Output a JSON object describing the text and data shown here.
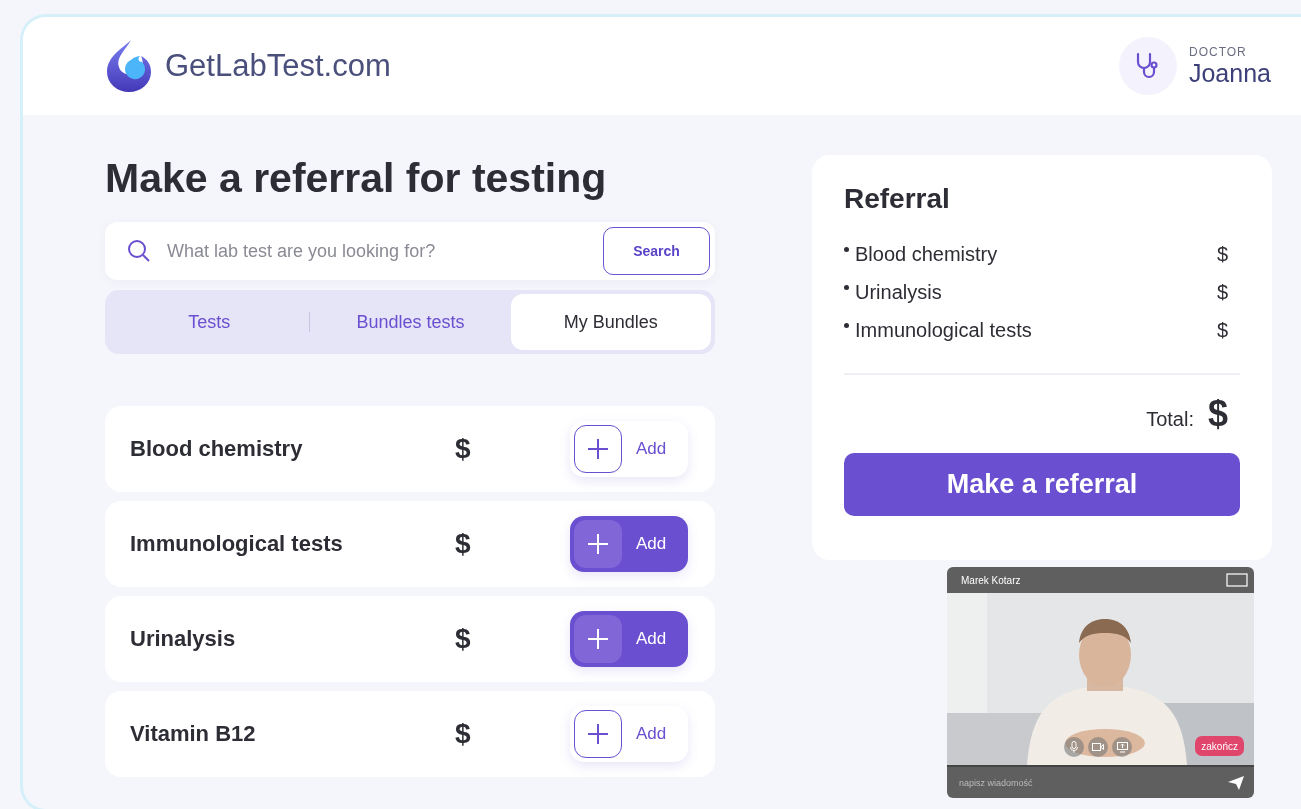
{
  "header": {
    "logo_text": "GetLabTest.com",
    "user": {
      "role": "DOCTOR",
      "name": "Joanna"
    }
  },
  "title": "Make a referral for testing",
  "search": {
    "placeholder": "What lab test are you looking for?",
    "button": "Search"
  },
  "tabs": [
    {
      "label": "Tests",
      "selected": false
    },
    {
      "label": "Bundles tests",
      "selected": false
    },
    {
      "label": "My Bundles",
      "selected": true
    }
  ],
  "tests": [
    {
      "name": "Blood chemistry",
      "price": "$",
      "button": "Add",
      "added": false
    },
    {
      "name": "Immunological tests",
      "price": "$",
      "button": "Add",
      "added": true
    },
    {
      "name": "Urinalysis",
      "price": "$",
      "button": "Add",
      "added": true
    },
    {
      "name": "Vitamin B12",
      "price": "$",
      "button": "Add",
      "added": false
    }
  ],
  "referral": {
    "title": "Referral",
    "items": [
      {
        "name": "Blood chemistry",
        "price": "$"
      },
      {
        "name": "Urinalysis",
        "price": "$"
      },
      {
        "name": "Immunological tests",
        "price": "$"
      }
    ],
    "total_label": "Total:",
    "total_value": "$",
    "button": "Make a referral"
  },
  "video_call": {
    "caller": "Marek Kotarz",
    "end_button": "zakończ",
    "message_placeholder": "napisz wiadomość"
  }
}
